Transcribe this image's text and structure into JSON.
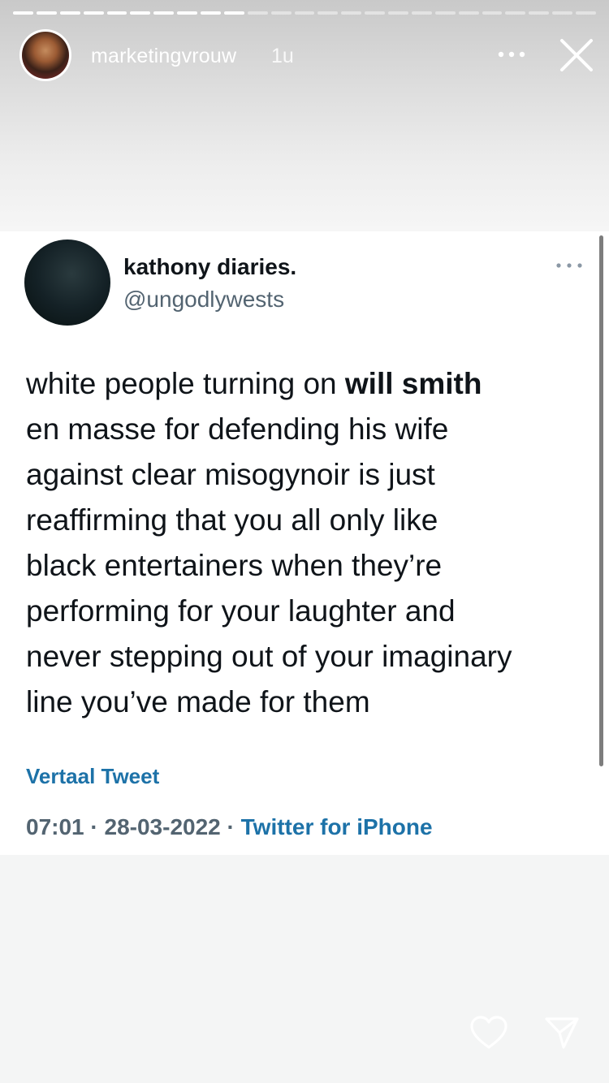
{
  "story": {
    "username": "marketingvrouw",
    "time_ago": "1u",
    "progress": {
      "segments": 25,
      "completed": 10
    }
  },
  "tweet": {
    "display_name": "kathony diaries.",
    "handle": "@ungodlywests",
    "text_lines": [
      {
        "pre": "white people turning on ",
        "bold": "will smith"
      },
      {
        "pre": "en masse for defending his wife",
        "bold": ""
      },
      {
        "pre": "against clear misogynoir is just",
        "bold": ""
      },
      {
        "pre": "reaffirming that you all only like",
        "bold": ""
      },
      {
        "pre": "black entertainers when they’re",
        "bold": ""
      },
      {
        "pre": "performing for your laughter and",
        "bold": ""
      },
      {
        "pre": "never stepping out of your imaginary",
        "bold": ""
      },
      {
        "pre": "line you’ve made for them",
        "bold": ""
      }
    ],
    "translate_label": "Vertaal Tweet",
    "time": "07:01",
    "date": "28-03-2022",
    "separator": "·",
    "source": "Twitter for iPhone"
  },
  "icons": {
    "more_top": "more-horizontal-icon",
    "close": "close-icon",
    "tweet_more": "more-horizontal-icon",
    "like": "heart-icon",
    "share": "send-icon"
  },
  "colors": {
    "tweet_text": "#0f1419",
    "secondary_text": "#536471",
    "link_blue": "#1d72a8"
  }
}
